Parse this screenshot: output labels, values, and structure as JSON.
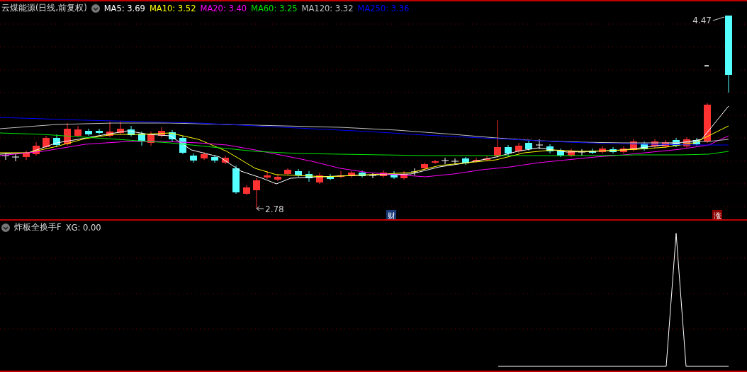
{
  "title": "云煤能源(日线,前复权)",
  "ma_legend": [
    {
      "text": "MA5: 3.69",
      "color": "#ffffff"
    },
    {
      "text": "MA10: 3.52",
      "color": "#ffff00"
    },
    {
      "text": "MA20: 3.40",
      "color": "#ff00ff"
    },
    {
      "text": "MA60: 3.25",
      "color": "#00e600"
    },
    {
      "text": "MA120: 3.32",
      "color": "#c0c0c0"
    },
    {
      "text": "MA250: 3.36",
      "color": "#0000ff"
    }
  ],
  "price_labels": {
    "high": "4.47",
    "low": "2.78"
  },
  "event_markers": [
    {
      "kind": "finance",
      "text": "财"
    },
    {
      "kind": "limit_up",
      "text": "涨"
    }
  ],
  "indicator": {
    "name": "炸板全换手F",
    "reading": "XG: 0.00"
  }
}
